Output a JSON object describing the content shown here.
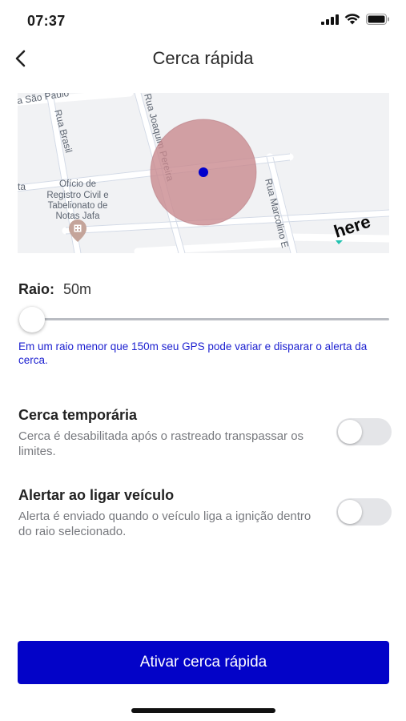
{
  "status_bar": {
    "time": "07:37"
  },
  "header": {
    "title": "Cerca rápida"
  },
  "map": {
    "streets": [
      "a São Paulo",
      "Rua Brasil",
      "Rua Joaquim Pereira",
      "Rua Marcolino E",
      "ta"
    ],
    "poi_lines": [
      "Ofício de",
      "Registro Civil e",
      "Tabelionato de",
      "Notas Jafa"
    ],
    "logo": "here",
    "fence_color": "#c98a8f",
    "center_color": "#0000cc"
  },
  "radius": {
    "label": "Raio:",
    "value": "50m",
    "slider_fraction": 0.0
  },
  "hint": "Em um raio menor que 150m seu GPS pode variar e disparar o alerta da cerca.",
  "settings": [
    {
      "title": "Cerca temporária",
      "description": "Cerca é desabilitada após o rastreado transpassar os limites.",
      "enabled": false
    },
    {
      "title": "Alertar ao ligar veículo",
      "description": "Alerta é enviado quando o veículo liga a ignição dentro do raio selecionado.",
      "enabled": false
    }
  ],
  "action": {
    "label": "Ativar cerca rápida"
  },
  "colors": {
    "primary": "#0303c8",
    "hint_text": "#1b1fd0"
  }
}
